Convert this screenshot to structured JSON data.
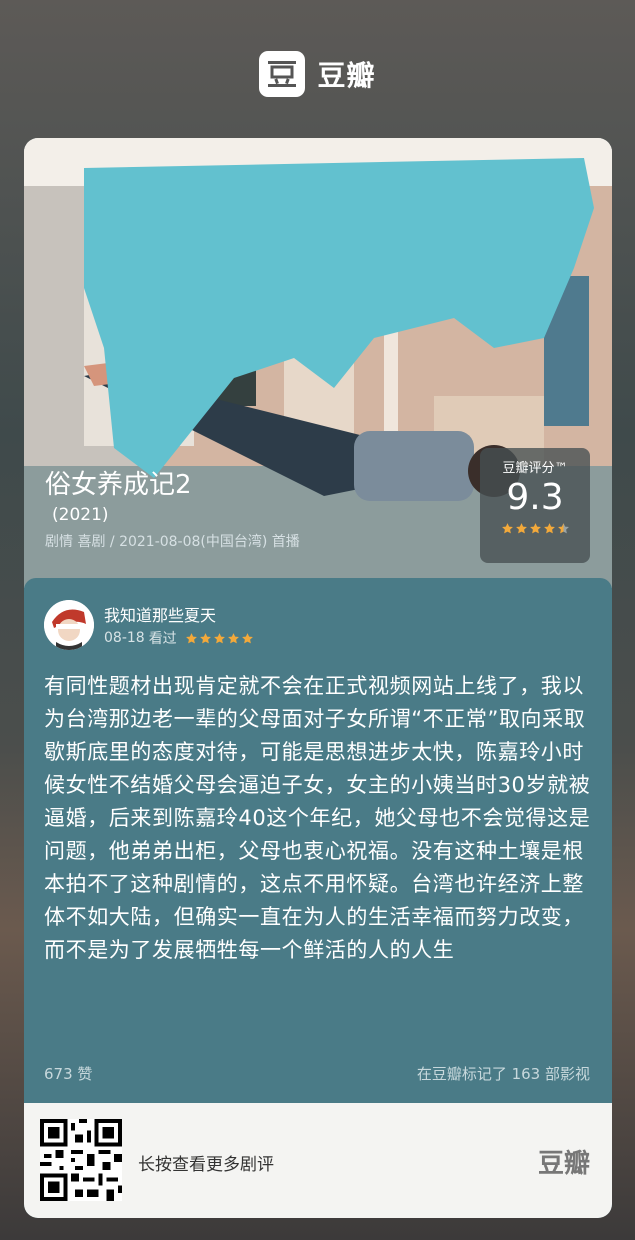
{
  "header": {
    "brand_name": "豆瓣",
    "logo_icon": "douban-logo-icon"
  },
  "show": {
    "title": "俗女养成记2",
    "year": "(2021)",
    "meta": "剧情 喜剧 / 2021-08-08(中国台湾) 首播"
  },
  "rating": {
    "label": "豆瓣评分™",
    "score": "9.3",
    "stars": 4.5
  },
  "review": {
    "reviewer_name": "我知道那些夏天",
    "date": "08-18",
    "status": "看过",
    "stars": 5,
    "text": "有同性题材出现肯定就不会在正式视频网站上线了，我以为台湾那边老一辈的父母面对子女所谓“不正常”取向采取歇斯底里的态度对待，可能是思想进步太快，陈嘉玲小时候女性不结婚父母会逼迫子女，女主的小姨当时30岁就被逼婚，后来到陈嘉玲40这个年纪，她父母也不会觉得这是问题，他弟弟出柜，父母也衷心祝福。没有这种土壤是根本拍不了这种剧情的，这点不用怀疑。台湾也许经济上整体不如大陆，但确实一直在为人的生活幸福而努力改变，而不是为了发展牺牲每一个鲜活的人的人生",
    "likes": "673 赞",
    "marked": "在豆瓣标记了 163 部影视"
  },
  "footer": {
    "hint": "长按查看更多剧评",
    "brand": "豆瓣"
  },
  "colors": {
    "star": "#f2a93b",
    "card_bg": "#3f6f7c",
    "review_bg": "#4a7b87"
  }
}
